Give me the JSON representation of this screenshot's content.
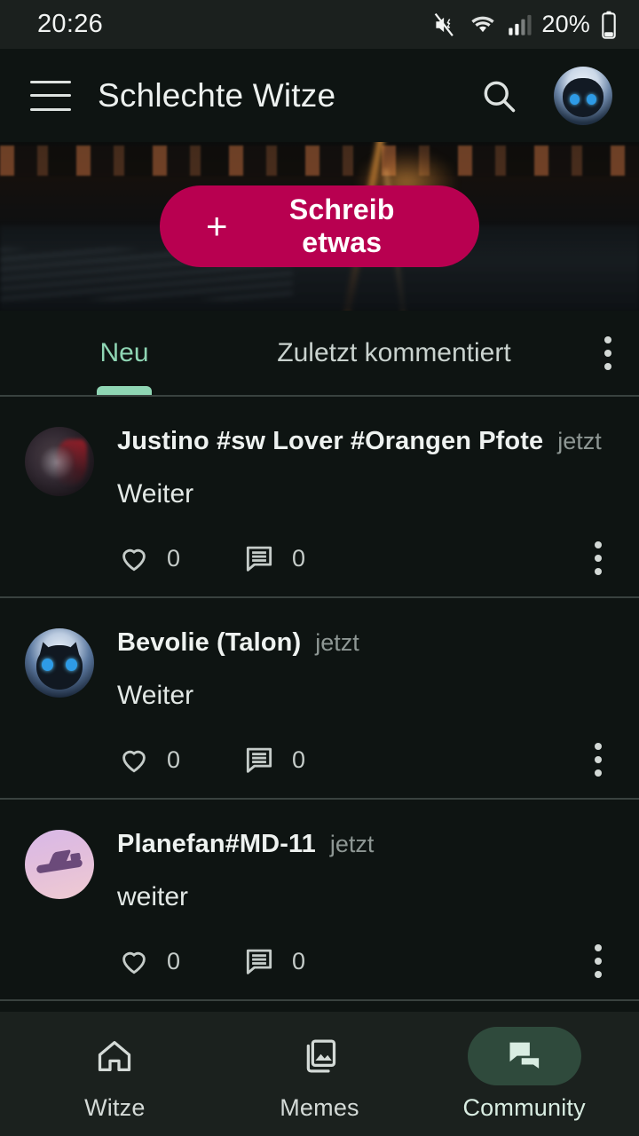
{
  "status_bar": {
    "time": "20:26",
    "battery_percent": "20%",
    "icons": [
      "mute-icon",
      "wifi-icon",
      "signal-icon",
      "battery-icon"
    ]
  },
  "app_bar": {
    "menu_icon": "hamburger-menu-icon",
    "title": "Schlechte Witze",
    "search_icon": "search-icon",
    "avatar": "user-avatar"
  },
  "banner": {
    "compose_button": {
      "plus": "+",
      "label": "Schreib etwas"
    }
  },
  "tabs": {
    "items": [
      {
        "label": "Neu",
        "active": true
      },
      {
        "label": "Zuletzt kommentiert",
        "active": false
      }
    ],
    "overflow_icon": "more-vertical-icon"
  },
  "feed": {
    "posts": [
      {
        "author": "Justino #sw Lover #Orangen Pfote",
        "time": "jetzt",
        "text": "Weiter",
        "likes": "0",
        "comments": "0",
        "avatar": "wolf-avatar"
      },
      {
        "author": "Bevolie (Talon)",
        "time": "jetzt",
        "text": "Weiter",
        "likes": "0",
        "comments": "0",
        "avatar": "cat-avatar"
      },
      {
        "author": "Planefan#MD-11",
        "time": "jetzt",
        "text": "weiter",
        "likes": "0",
        "comments": "0",
        "avatar": "airplane-avatar"
      }
    ]
  },
  "bottom_nav": {
    "items": [
      {
        "label": "Witze",
        "icon": "home-icon",
        "active": false
      },
      {
        "label": "Memes",
        "icon": "photo-library-icon",
        "active": false
      },
      {
        "label": "Community",
        "icon": "chat-bubbles-icon",
        "active": true
      }
    ]
  },
  "colors": {
    "background": "#0E1412",
    "surface": "#1B211E",
    "accent_pink": "#B80050",
    "accent_green": "#8FD6B4",
    "active_pill": "#2F4A3C",
    "divider": "#39423F",
    "text_primary": "#EEF2F0",
    "text_secondary": "#8E9794"
  }
}
